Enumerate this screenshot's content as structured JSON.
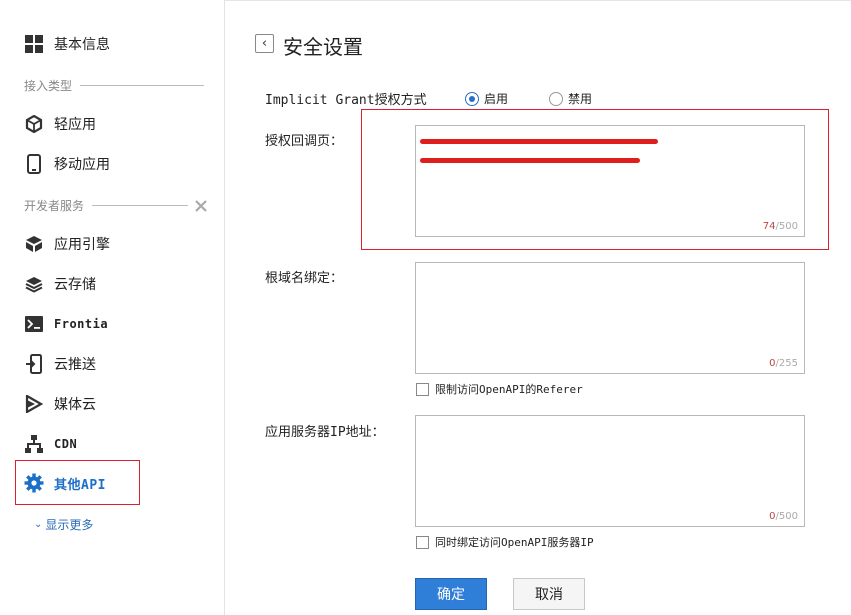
{
  "sidebar": {
    "basic_info": "基本信息",
    "section_access": "接入类型",
    "light_app": "轻应用",
    "mobile_app": "移动应用",
    "section_dev": "开发者服务",
    "app_engine": "应用引擎",
    "cloud_storage": "云存储",
    "frontia": "Frontia",
    "cloud_push": "云推送",
    "media_cloud": "媒体云",
    "cdn": "CDN",
    "other_api": "其他API",
    "show_more": "显示更多"
  },
  "main": {
    "title": "安全设置",
    "grant_label": "Implicit Grant授权方式",
    "radio_enable": "启用",
    "radio_disable": "禁用",
    "radio_selected": "启用",
    "callback_label": "授权回调页：",
    "callback_count": "74",
    "callback_max": "/500",
    "root_domain_label": "根域名绑定：",
    "root_domain_count": "0",
    "root_domain_max": "/255",
    "referer_check": "限制访问OpenAPI的Referer",
    "server_ip_label": "应用服务器IP地址：",
    "server_ip_count": "0",
    "server_ip_max": "/500",
    "bind_ip_check": "同时绑定访问OpenAPI服务器IP",
    "confirm": "确定",
    "cancel": "取消"
  },
  "colors": {
    "accent": "#2f7ed8",
    "active_link": "#1c6fc9",
    "highlight_border": "#d8232a",
    "redaction": "#e01e1e"
  }
}
